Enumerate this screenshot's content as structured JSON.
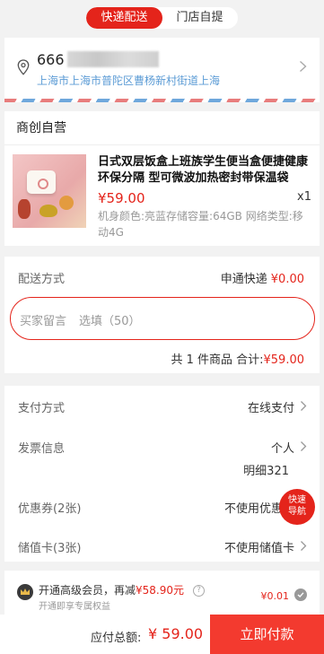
{
  "tabs": [
    {
      "label": "快递配送",
      "active": true
    },
    {
      "label": "门店自提",
      "active": false
    }
  ],
  "address": {
    "name": "666",
    "detail": "上海市上海市普陀区曹杨新村街道上海"
  },
  "store": {
    "name": "商创自营"
  },
  "product": {
    "title": "日式双层饭盒上班族学生便当盒便捷健康环保分隔 型可微波加热密封带保温袋",
    "price": "¥59.00",
    "qty": "x1",
    "spec": "机身颜色:亮蓝存储容量:64GB 网络类型:移动4G"
  },
  "delivery": {
    "label": "配送方式",
    "method": "申通快递",
    "fee": "¥0.00",
    "note_label": "买家留言",
    "note_placeholder": "选填（50）",
    "summary_prefix": "共 1 件商品 合计:",
    "summary_amount": "¥59.00"
  },
  "payment": {
    "rows": [
      {
        "label": "支付方式",
        "value": "在线支付"
      },
      {
        "label": "发票信息",
        "value": "个人"
      },
      {
        "label": "优惠券(2张)",
        "value": "不使用优惠券"
      },
      {
        "label": "储值卡(3张)",
        "value": "不使用储值卡"
      }
    ],
    "invoice_detail": "明细321"
  },
  "fab": {
    "line1": "快速",
    "line2": "导航"
  },
  "member": {
    "title_prefix": "开通高级会员，再减",
    "title_amount": "¥58.90元",
    "subtitle": "开通即享专属权益",
    "price": "¥0.01"
  },
  "bottom": {
    "total_label": "应付总额:",
    "total_amount": "¥ 59.00",
    "pay_button": "立即付款"
  },
  "colors": {
    "accent": "#e4241b",
    "link_blue": "#5b9bd5"
  },
  "icons": {
    "location": "location-pin-icon",
    "arrow": "chevron-right-icon",
    "crown": "crown-icon",
    "help": "question-icon",
    "check": "check-circle-icon"
  }
}
